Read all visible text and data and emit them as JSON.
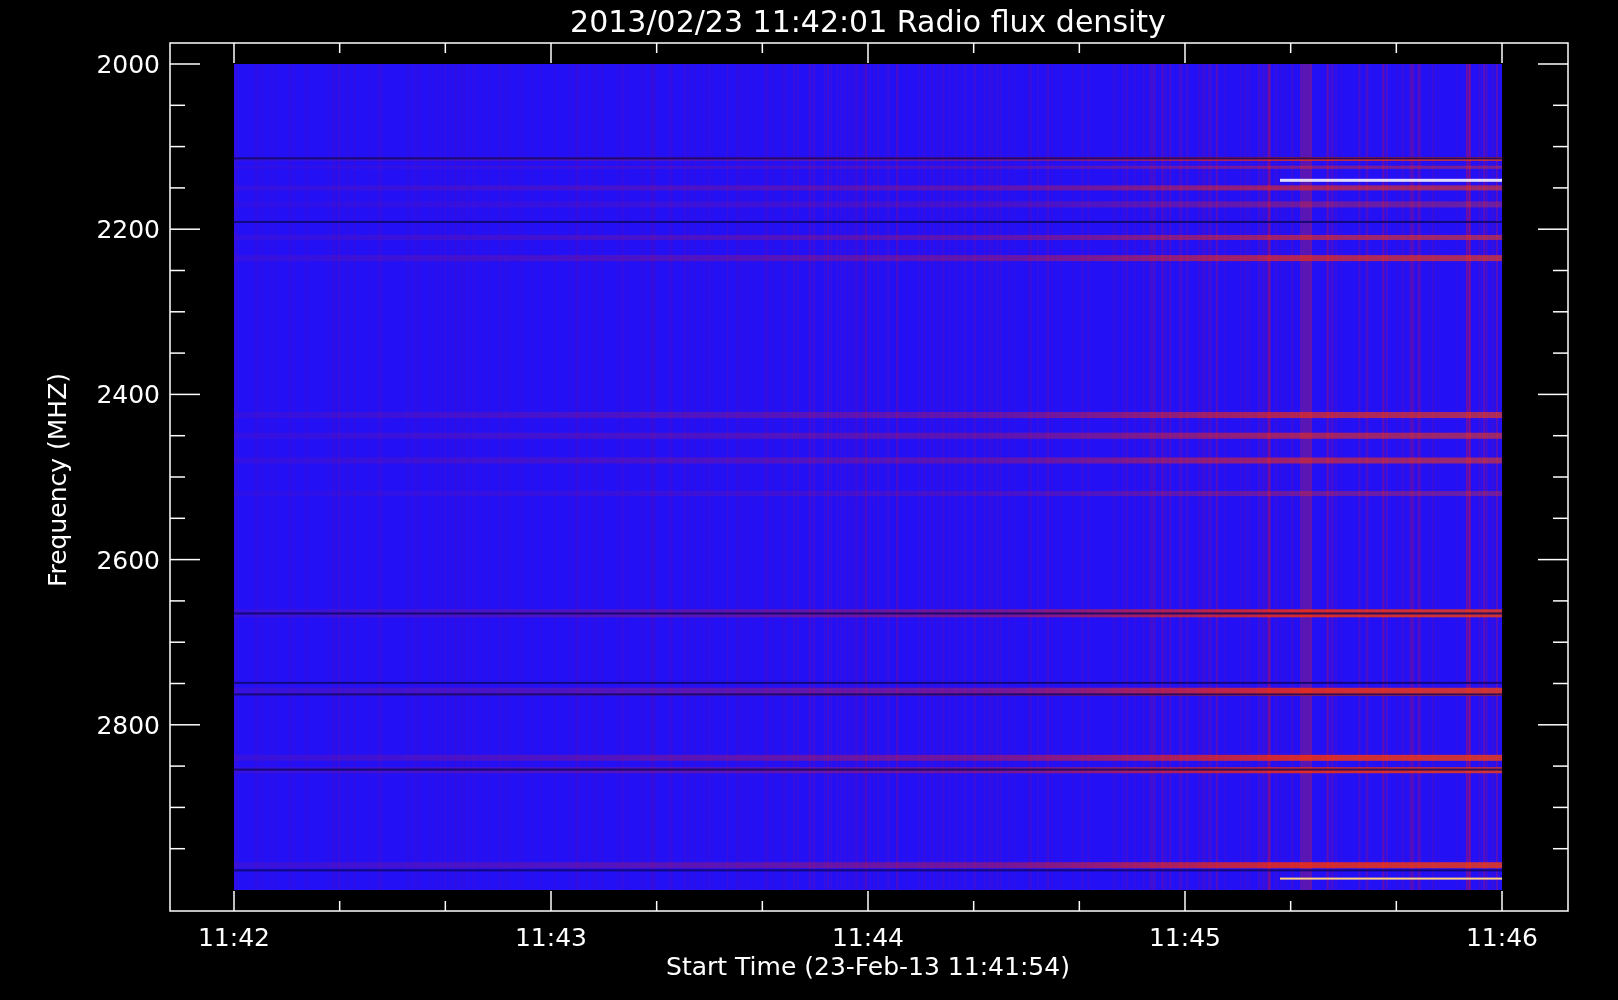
{
  "title": "2013/02/23 11:42:01 Radio flux density",
  "plot": {
    "ylabel": "Frequency (MHZ)",
    "xlabel": "Start Time (23-Feb-13 11:41:54)",
    "yticks": [
      "2000",
      "2200",
      "2400",
      "2600",
      "2800"
    ],
    "xticks": [
      "11:42",
      "11:43",
      "11:44",
      "11:45",
      "11:46"
    ]
  }
}
